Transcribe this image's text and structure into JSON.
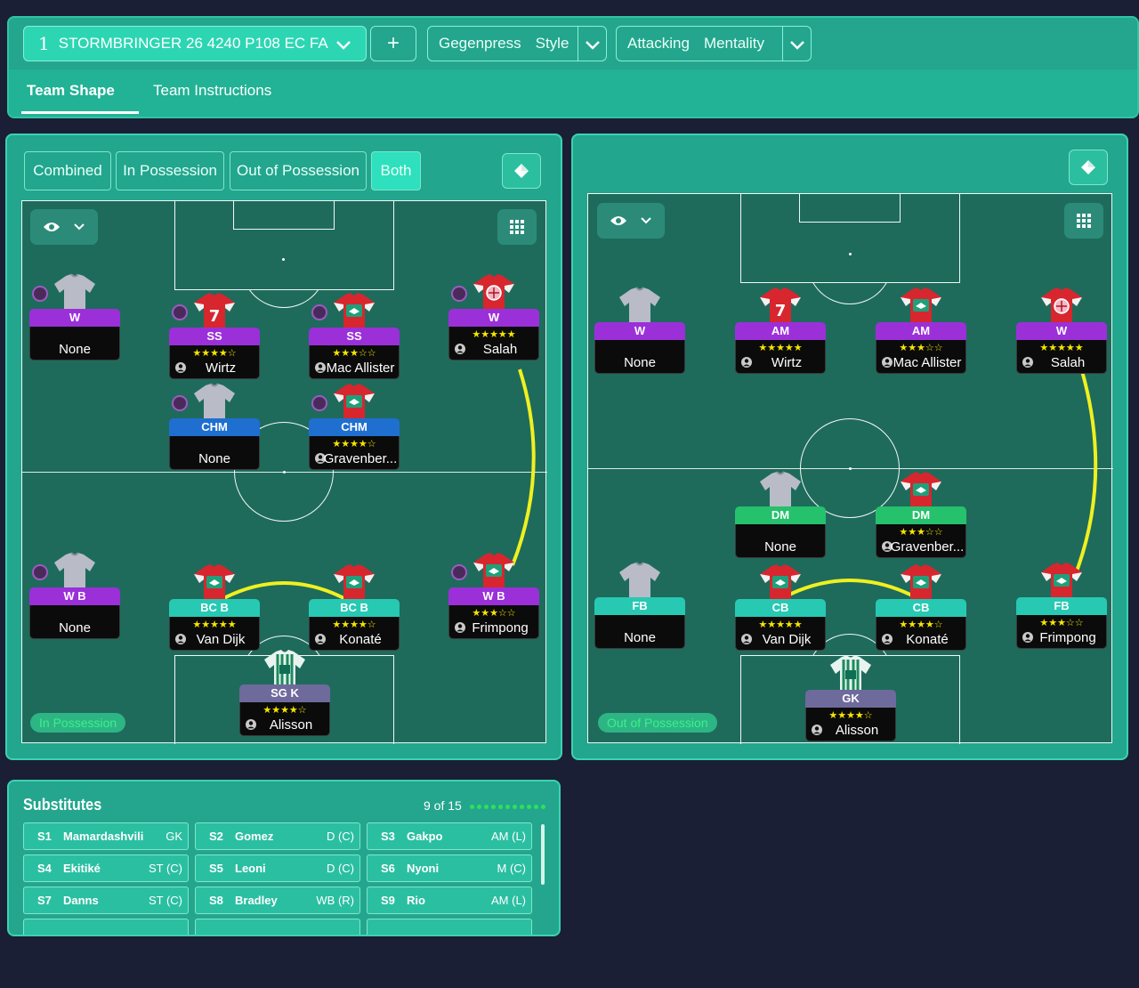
{
  "header": {
    "tactic_number": "1",
    "tactic_name": "STORMBRINGER 26 4240 P108 EC FA",
    "add_label": "+",
    "style_value": "Gegenpress",
    "style_label": "Style",
    "mentality_value": "Attacking",
    "mentality_label": "Mentality",
    "tabs": [
      "Team Shape",
      "Team Instructions"
    ]
  },
  "left_panel": {
    "segments": [
      "Combined",
      "In Possession",
      "Out of Possession",
      "Both"
    ],
    "active_segment": "Both",
    "phase_label": "In Possession",
    "players": [
      {
        "role": "W",
        "name": "None",
        "stars": ""
      },
      {
        "role": "SS",
        "name": "Wirtz",
        "stars": "★★★★☆"
      },
      {
        "role": "SS",
        "name": "Mac Allister",
        "stars": "★★★☆☆"
      },
      {
        "role": "W",
        "name": "Salah",
        "stars": "★★★★★"
      },
      {
        "role": "CHM",
        "name": "None",
        "stars": ""
      },
      {
        "role": "CHM",
        "name": "Gravenber...",
        "stars": "★★★★☆"
      },
      {
        "role": "W B",
        "name": "None",
        "stars": ""
      },
      {
        "role": "BC B",
        "name": "Van Dijk",
        "stars": "★★★★★"
      },
      {
        "role": "BC B",
        "name": "Konaté",
        "stars": "★★★★☆"
      },
      {
        "role": "W B",
        "name": "Frimpong",
        "stars": "★★★☆☆"
      },
      {
        "role": "SG K",
        "name": "Alisson",
        "stars": "★★★★☆"
      }
    ]
  },
  "right_panel": {
    "phase_label": "Out of Possession",
    "players": [
      {
        "role": "W",
        "name": "None",
        "stars": ""
      },
      {
        "role": "AM",
        "name": "Wirtz",
        "stars": "★★★★★"
      },
      {
        "role": "AM",
        "name": "Mac Allister",
        "stars": "★★★☆☆"
      },
      {
        "role": "W",
        "name": "Salah",
        "stars": "★★★★★"
      },
      {
        "role": "DM",
        "name": "None",
        "stars": ""
      },
      {
        "role": "DM",
        "name": "Gravenber...",
        "stars": "★★★☆☆"
      },
      {
        "role": "FB",
        "name": "None",
        "stars": ""
      },
      {
        "role": "CB",
        "name": "Van Dijk",
        "stars": "★★★★★"
      },
      {
        "role": "CB",
        "name": "Konaté",
        "stars": "★★★★☆"
      },
      {
        "role": "FB",
        "name": "Frimpong",
        "stars": "★★★☆☆"
      },
      {
        "role": "GK",
        "name": "Alisson",
        "stars": "★★★★☆"
      }
    ]
  },
  "substitutes": {
    "title": "Substitutes",
    "count": "9 of 15",
    "items": [
      {
        "slot": "S1",
        "name": "Mamardashvili",
        "pos": "GK"
      },
      {
        "slot": "S2",
        "name": "Gomez",
        "pos": "D (C)"
      },
      {
        "slot": "S3",
        "name": "Gakpo",
        "pos": "AM (L)"
      },
      {
        "slot": "S4",
        "name": "Ekitiké",
        "pos": "ST (C)"
      },
      {
        "slot": "S5",
        "name": "Leoni",
        "pos": "D (C)"
      },
      {
        "slot": "S6",
        "name": "Nyoni",
        "pos": "M (C)"
      },
      {
        "slot": "S7",
        "name": "Danns",
        "pos": "ST (C)"
      },
      {
        "slot": "S8",
        "name": "Bradley",
        "pos": "WB (R)"
      },
      {
        "slot": "S9",
        "name": "Rio",
        "pos": "AM (L)"
      }
    ]
  },
  "colors": {
    "background": "#1a1f35",
    "panel": "#22a68e",
    "pitch": "#1e6b5c",
    "link_line": "#f0f020",
    "role_attack": "#9b30d9",
    "role_midfield": "#1f6fd1",
    "role_defence": "#27c9b3",
    "role_dm": "#26c16d",
    "role_gk": "#6e6a9c"
  },
  "icons": [
    "chevron-down-icon",
    "plus-icon",
    "diamond-icon",
    "eye-icon",
    "grid-icon",
    "person-icon",
    "shirt-icon"
  ]
}
